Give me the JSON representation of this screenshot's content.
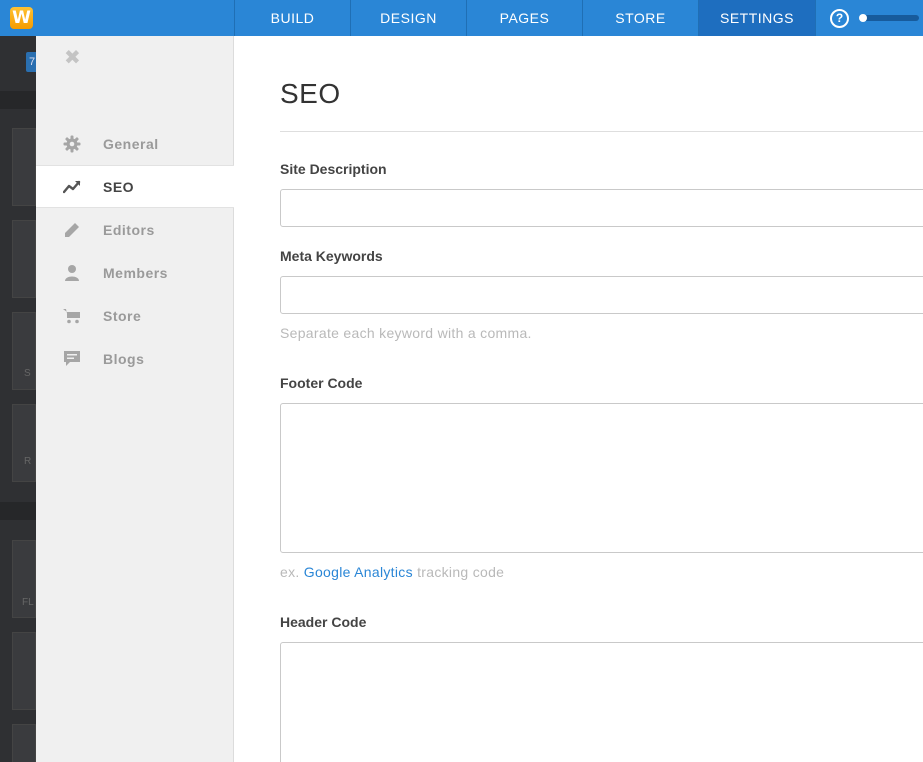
{
  "app": {
    "logo_letter": "W"
  },
  "nav": {
    "tabs": [
      {
        "label": "BUILD"
      },
      {
        "label": "DESIGN"
      },
      {
        "label": "PAGES"
      },
      {
        "label": "STORE"
      },
      {
        "label": "SETTINGS",
        "active": true
      }
    ],
    "help_label": "?"
  },
  "background": {
    "button_label": "7",
    "letters": [
      "S",
      "R",
      "FL"
    ]
  },
  "sidebar": {
    "close_icon": "close-icon",
    "items": [
      {
        "label": "General",
        "icon": "gear-icon"
      },
      {
        "label": "SEO",
        "icon": "trend-icon",
        "active": true
      },
      {
        "label": "Editors",
        "icon": "pencil-icon"
      },
      {
        "label": "Members",
        "icon": "user-icon"
      },
      {
        "label": "Store",
        "icon": "cart-icon"
      },
      {
        "label": "Blogs",
        "icon": "comment-icon"
      }
    ]
  },
  "main": {
    "title": "SEO",
    "site_description": {
      "label": "Site Description",
      "value": ""
    },
    "meta_keywords": {
      "label": "Meta Keywords",
      "value": "",
      "hint": "Separate each keyword with a comma."
    },
    "footer_code": {
      "label": "Footer Code",
      "value": "",
      "hint_prefix": "ex.",
      "hint_link": "Google Analytics",
      "hint_suffix": "tracking code"
    },
    "header_code": {
      "label": "Header Code",
      "value": ""
    }
  },
  "colors": {
    "topbar": "#2a86d6",
    "active_tab": "#1e6ebf",
    "link": "#2a86d6",
    "sidebar_bg": "#f0f0f0"
  }
}
